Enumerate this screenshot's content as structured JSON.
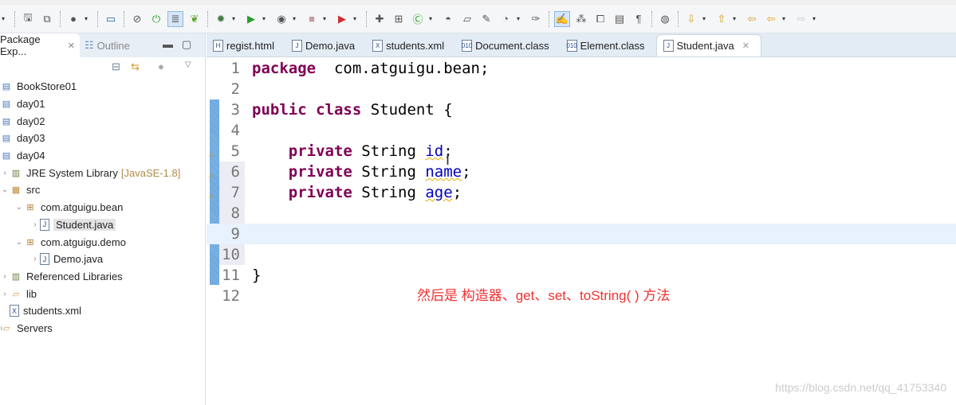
{
  "toolbar": {
    "icons": [
      "dropdown",
      "save-icon",
      "save-all-icon",
      "user-icon",
      "monitor-icon",
      "skip-breakpoints-icon",
      "power-icon",
      "line-numbers-icon",
      "spring-icon",
      "debug-icon",
      "run-icon",
      "run-external-icon",
      "stop-icon",
      "deploy-icon",
      "new-project-icon",
      "new-package-icon",
      "new-class-icon",
      "open-type-icon",
      "open-folder-icon",
      "search-icon",
      "open-task-icon",
      "pin-icon",
      "mark-occurrences-icon",
      "toggle-icon",
      "block-select-icon",
      "word-wrap-icon",
      "show-whitespace-icon",
      "globe-icon",
      "next-annotation-icon",
      "prev-annotation-icon",
      "last-edit-icon",
      "back-icon",
      "forward-icon"
    ]
  },
  "left_panel": {
    "tabs": [
      {
        "label": "Package Exp...",
        "close": "✕"
      },
      {
        "label": "Outline"
      }
    ],
    "tree": [
      {
        "label": "BookStore01",
        "level": 0,
        "icon": "project-icon"
      },
      {
        "label": "day01",
        "level": 0,
        "icon": "project-icon"
      },
      {
        "label": "day02",
        "level": 0,
        "icon": "project-icon"
      },
      {
        "label": "day03",
        "level": 0,
        "icon": "project-icon"
      },
      {
        "label": "day04",
        "level": 0,
        "icon": "project-icon"
      },
      {
        "label": "JRE System Library",
        "suffix": "[JavaSE-1.8]",
        "level": 1,
        "icon": "library-icon",
        "toggle": "›"
      },
      {
        "label": "src",
        "level": 1,
        "icon": "source-folder-icon",
        "toggle": "⌄"
      },
      {
        "label": "com.atguigu.bean",
        "level": 2,
        "icon": "package-icon",
        "toggle": "⌄"
      },
      {
        "label": "Student.java",
        "level": 3,
        "icon": "java-file-icon",
        "toggle": "›",
        "selected": true
      },
      {
        "label": "com.atguigu.demo",
        "level": 2,
        "icon": "package-icon",
        "toggle": "⌄"
      },
      {
        "label": "Demo.java",
        "level": 3,
        "icon": "java-file-icon",
        "toggle": "›"
      },
      {
        "label": "Referenced Libraries",
        "level": 1,
        "icon": "library-icon",
        "toggle": "›"
      },
      {
        "label": "lib",
        "level": 1,
        "icon": "folder-icon",
        "toggle": "›"
      },
      {
        "label": "students.xml",
        "level": 1,
        "icon": "xml-file-icon"
      },
      {
        "label": "Servers",
        "level": 0,
        "icon": "folder-icon",
        "toggle": "›"
      }
    ]
  },
  "editor": {
    "tabs": [
      {
        "label": "regist.html",
        "icon": "H"
      },
      {
        "label": "Demo.java",
        "icon": "J"
      },
      {
        "label": "students.xml",
        "icon": "X"
      },
      {
        "label": "Document.class",
        "icon": "010"
      },
      {
        "label": "Element.class",
        "icon": "010"
      },
      {
        "label": "Student.java",
        "icon": "J",
        "active": true,
        "close": "✕"
      }
    ],
    "lines": [
      {
        "n": "1",
        "parts": [
          [
            "kw",
            "package"
          ],
          [
            "",
            "  com.atguigu.bean;"
          ]
        ]
      },
      {
        "n": "2",
        "parts": []
      },
      {
        "n": "3",
        "parts": [
          [
            "kw",
            "public"
          ],
          [
            "",
            " "
          ],
          [
            "kw",
            "class"
          ],
          [
            "",
            " Student {"
          ]
        ]
      },
      {
        "n": "4",
        "parts": []
      },
      {
        "n": "5",
        "warn": true,
        "parts": [
          [
            "",
            "    "
          ],
          [
            "kw",
            "private"
          ],
          [
            "",
            " String "
          ],
          [
            "fld",
            "id"
          ],
          [
            "",
            ";"
          ]
        ]
      },
      {
        "n": "6",
        "warn": true,
        "parts": [
          [
            "",
            "    "
          ],
          [
            "kw",
            "private"
          ],
          [
            "",
            " String "
          ],
          [
            "fld",
            "name"
          ],
          [
            "",
            ";"
          ]
        ]
      },
      {
        "n": "7",
        "warn": true,
        "parts": [
          [
            "",
            "    "
          ],
          [
            "kw",
            "private"
          ],
          [
            "",
            " String "
          ],
          [
            "fld",
            "age"
          ],
          [
            "",
            ";"
          ]
        ]
      },
      {
        "n": "8",
        "parts": []
      },
      {
        "n": "9",
        "current": true,
        "parts": []
      },
      {
        "n": "10",
        "parts": []
      },
      {
        "n": "11",
        "parts": [
          [
            "",
            "}"
          ]
        ]
      },
      {
        "n": "12",
        "parts": []
      }
    ],
    "annotation": "然后是 构造器、get、set、toString( ) 方法"
  },
  "watermark": "https://blog.csdn.net/qq_41753340",
  "colors": {
    "keyword": "#7f0055",
    "field": "#0000c0",
    "annotation": "#f03030"
  }
}
